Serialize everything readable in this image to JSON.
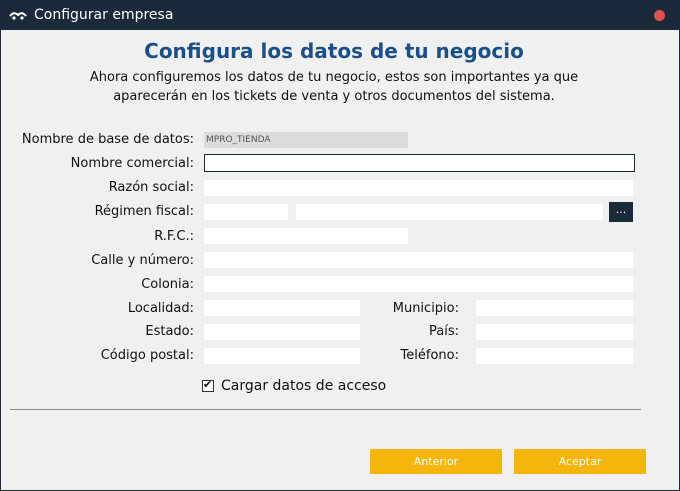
{
  "window": {
    "title": "Configurar empresa"
  },
  "header": {
    "heading": "Configura los datos de tu negocio",
    "subtitle": "Ahora configuremos los datos de tu negocio, estos son importantes ya que aparecerán en los tickets de venta y otros documentos del sistema."
  },
  "form": {
    "db_name_label": "Nombre de base de datos:",
    "db_name_value": "MPRO_TIENDA",
    "commercial_name_label": "Nombre comercial:",
    "commercial_name_value": "",
    "business_name_label": "Razón social:",
    "business_name_value": "",
    "tax_regime_label": "Régimen fiscal:",
    "tax_regime_code": "",
    "tax_regime_desc": "",
    "tax_regime_button": "...",
    "rfc_label": "R.F.C.:",
    "rfc_value": "",
    "street_label": "Calle y número:",
    "street_value": "",
    "neighborhood_label": "Colonia:",
    "neighborhood_value": "",
    "locality_label": "Localidad:",
    "locality_value": "",
    "municipality_label": "Municipio:",
    "municipality_value": "",
    "state_label": "Estado:",
    "state_value": "",
    "country_label": "País:",
    "country_value": "",
    "postal_code_label": "Código postal:",
    "postal_code_value": "",
    "phone_label": "Teléfono:",
    "phone_value": "",
    "load_access_label": "Cargar datos de acceso",
    "load_access_checked": true
  },
  "footer": {
    "previous_label": "Anterior",
    "accept_label": "Aceptar"
  },
  "colors": {
    "titlebar": "#1b2a3a",
    "heading": "#1b4f8a",
    "button": "#f5b50a",
    "close": "#e2504f"
  }
}
